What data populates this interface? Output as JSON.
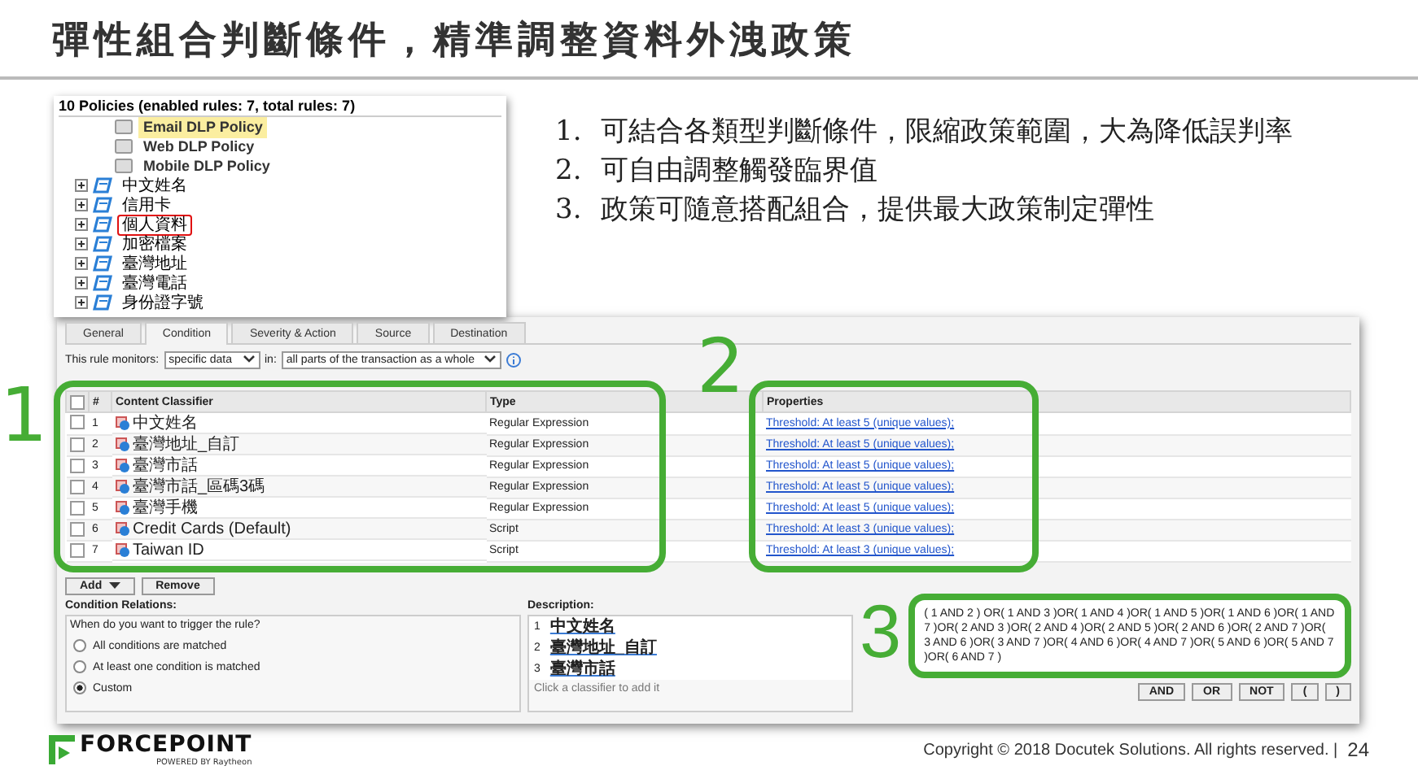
{
  "slide": {
    "title": "彈性組合判斷條件，精準調整資料外洩政策",
    "page_number": "24",
    "copyright": "Copyright © 2018 Docutek Solutions. All rights reserved. |",
    "logo": {
      "name": "FORCEPOINT",
      "tagline": "POWERED BY Raytheon"
    }
  },
  "policy_tree": {
    "header": "10 Policies (enabled rules: 7, total rules: 7)",
    "items": [
      {
        "label": "Email DLP Policy",
        "kind": "template",
        "selected": true,
        "highlighted": false
      },
      {
        "label": "Web DLP Policy",
        "kind": "template",
        "selected": false,
        "highlighted": false
      },
      {
        "label": "Mobile DLP Policy",
        "kind": "template",
        "selected": false,
        "highlighted": false
      },
      {
        "label": "中文姓名",
        "kind": "rule",
        "selected": false,
        "highlighted": false
      },
      {
        "label": "信用卡",
        "kind": "rule",
        "selected": false,
        "highlighted": false
      },
      {
        "label": "個人資料",
        "kind": "rule",
        "selected": false,
        "highlighted": true
      },
      {
        "label": "加密檔案",
        "kind": "rule",
        "selected": false,
        "highlighted": false
      },
      {
        "label": "臺灣地址",
        "kind": "rule",
        "selected": false,
        "highlighted": false
      },
      {
        "label": "臺灣電話",
        "kind": "rule",
        "selected": false,
        "highlighted": false
      },
      {
        "label": "身份證字號",
        "kind": "rule",
        "selected": false,
        "highlighted": false
      }
    ]
  },
  "points": [
    {
      "number": "1.",
      "text": "可結合各類型判斷條件，限縮政策範圍，大為降低誤判率"
    },
    {
      "number": "2.",
      "text": "可自由調整觸發臨界值"
    },
    {
      "number": "3.",
      "text": "政策可隨意搭配組合，提供最大政策制定彈性"
    }
  ],
  "rule_editor": {
    "tabs": [
      {
        "label": "General",
        "selected": false
      },
      {
        "label": "Condition",
        "selected": true
      },
      {
        "label": "Severity & Action",
        "selected": false
      },
      {
        "label": "Source",
        "selected": false
      },
      {
        "label": "Destination",
        "selected": false
      }
    ],
    "monitors_label": "This rule monitors:",
    "monitors_value": "specific data",
    "in_label": "in:",
    "in_value": "all parts of the transaction as a whole",
    "table": {
      "select_all_checked": false,
      "columns": [
        "#",
        "Content Classifier",
        "Type",
        "Properties"
      ],
      "rows": [
        {
          "checked": false,
          "number": "1",
          "classifier": "中文姓名",
          "type": "Regular Expression",
          "properties": "Threshold: At least 5 (unique values);"
        },
        {
          "checked": false,
          "number": "2",
          "classifier": "臺灣地址_自訂",
          "type": "Regular Expression",
          "properties": "Threshold: At least 5 (unique values);"
        },
        {
          "checked": false,
          "number": "3",
          "classifier": "臺灣市話",
          "type": "Regular Expression",
          "properties": "Threshold: At least 5 (unique values);"
        },
        {
          "checked": false,
          "number": "4",
          "classifier": "臺灣市話_區碼3碼",
          "type": "Regular Expression",
          "properties": "Threshold: At least 5 (unique values);"
        },
        {
          "checked": false,
          "number": "5",
          "classifier": "臺灣手機",
          "type": "Regular Expression",
          "properties": "Threshold: At least 5 (unique values);"
        },
        {
          "checked": false,
          "number": "6",
          "classifier": "Credit Cards (Default)",
          "type": "Script",
          "properties": "Threshold: At least 3 (unique values);"
        },
        {
          "checked": false,
          "number": "7",
          "classifier": "Taiwan ID",
          "type": "Script",
          "properties": "Threshold: At least 3 (unique values);"
        }
      ]
    },
    "table_buttons": [
      "Add",
      "Remove"
    ],
    "condition_relations": {
      "title": "Condition Relations:",
      "question": "When do you want to trigger the rule?",
      "options": [
        {
          "label": "All conditions are matched",
          "selected": false
        },
        {
          "label": "At least one condition is matched",
          "selected": false
        },
        {
          "label": "Custom",
          "selected": true
        }
      ]
    },
    "description": {
      "title": "Description:",
      "items": [
        {
          "number": "1",
          "label": "中文姓名"
        },
        {
          "number": "2",
          "label": "臺灣地址_自訂"
        },
        {
          "number": "3",
          "label": "臺灣市話"
        }
      ],
      "hint": "Click a classifier to add it"
    },
    "expression": "( 1 AND 2 ) OR( 1 AND 3 )OR( 1 AND 4 )OR( 1 AND 5 )OR( 1 AND 6 )OR( 1 AND 7 )OR( 2 AND 3 )OR( 2 AND 4 )OR( 2 AND 5 )OR( 2 AND 6 )OR( 2 AND 7 )OR( 3 AND 6 )OR( 3 AND 7 )OR( 4 AND 6 )OR( 4 AND 7 )OR( 5 AND 6 )OR( 5 AND 7 )OR( 6 AND 7 )",
    "operator_buttons": [
      "AND",
      "OR",
      "NOT",
      "(",
      ")"
    ]
  },
  "annotations": [
    "1",
    "2",
    "3"
  ]
}
